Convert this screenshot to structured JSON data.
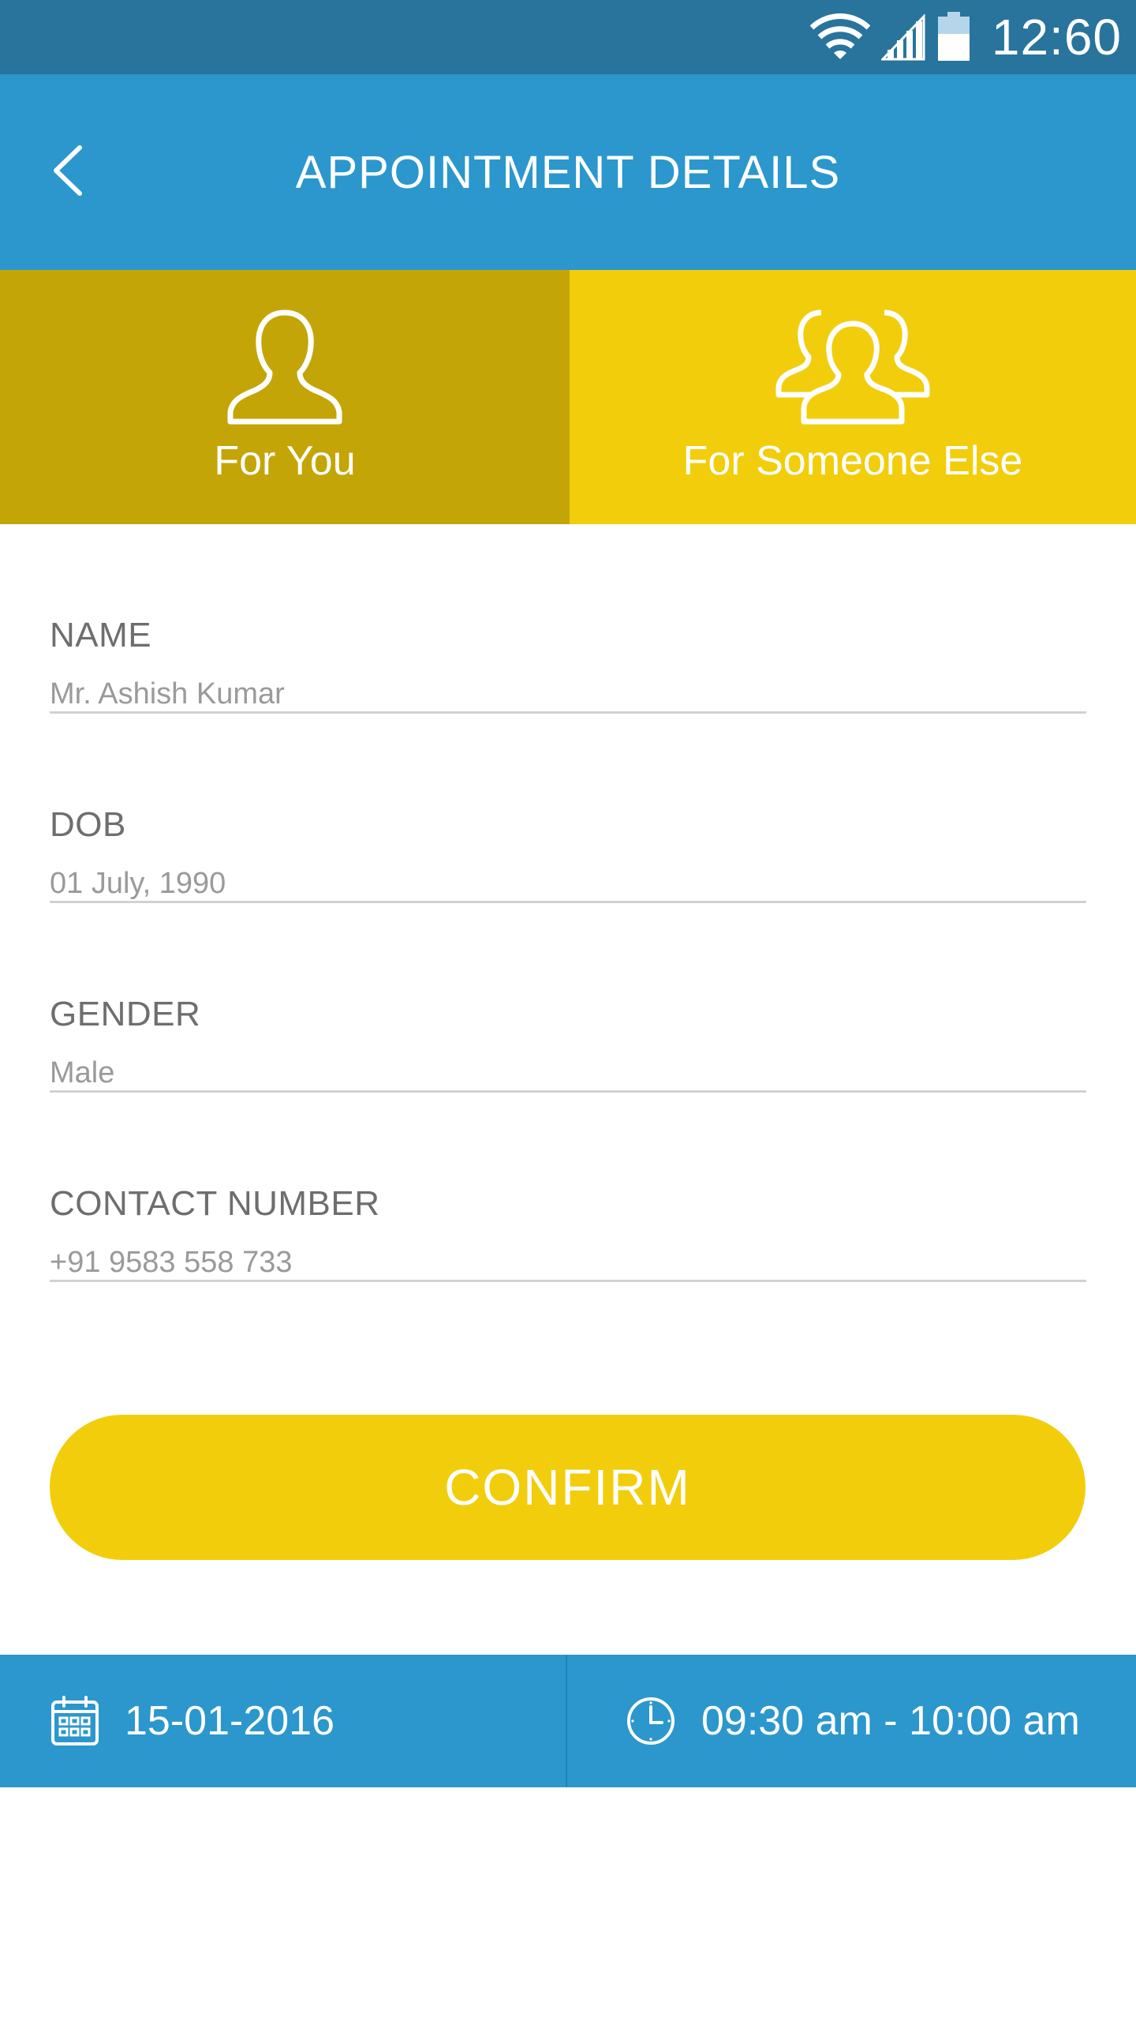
{
  "status_bar": {
    "time": "12:60",
    "icons": [
      "wifi-icon",
      "signal-icon",
      "battery-icon"
    ]
  },
  "app_bar": {
    "title": "APPOINTMENT DETAILS",
    "back_icon": "chevron-left-icon"
  },
  "tabs": [
    {
      "label": "For You",
      "icon": "person-icon",
      "selected": true
    },
    {
      "label": "For Someone Else",
      "icon": "group-icon",
      "selected": false
    }
  ],
  "form": {
    "fields": [
      {
        "label": "NAME",
        "value": "Mr. Ashish Kumar"
      },
      {
        "label": "DOB",
        "value": "01 July, 1990"
      },
      {
        "label": "GENDER",
        "value": "Male"
      },
      {
        "label": "CONTACT NUMBER",
        "value": "+91 9583 558 733"
      }
    ]
  },
  "confirm_button": {
    "label": "CONFIRM"
  },
  "bottom_bar": {
    "date": "15-01-2016",
    "date_icon": "calendar-icon",
    "time_range": "09:30 am - 10:00 am",
    "time_icon": "clock-icon"
  },
  "colors": {
    "status_bar": "#28749c",
    "primary_blue": "#2b97cd",
    "accent_yellow": "#f2cd0c",
    "selected_tab": "#c4a508",
    "label_gray": "#6e6e6e",
    "value_gray": "#9a9a9a"
  }
}
